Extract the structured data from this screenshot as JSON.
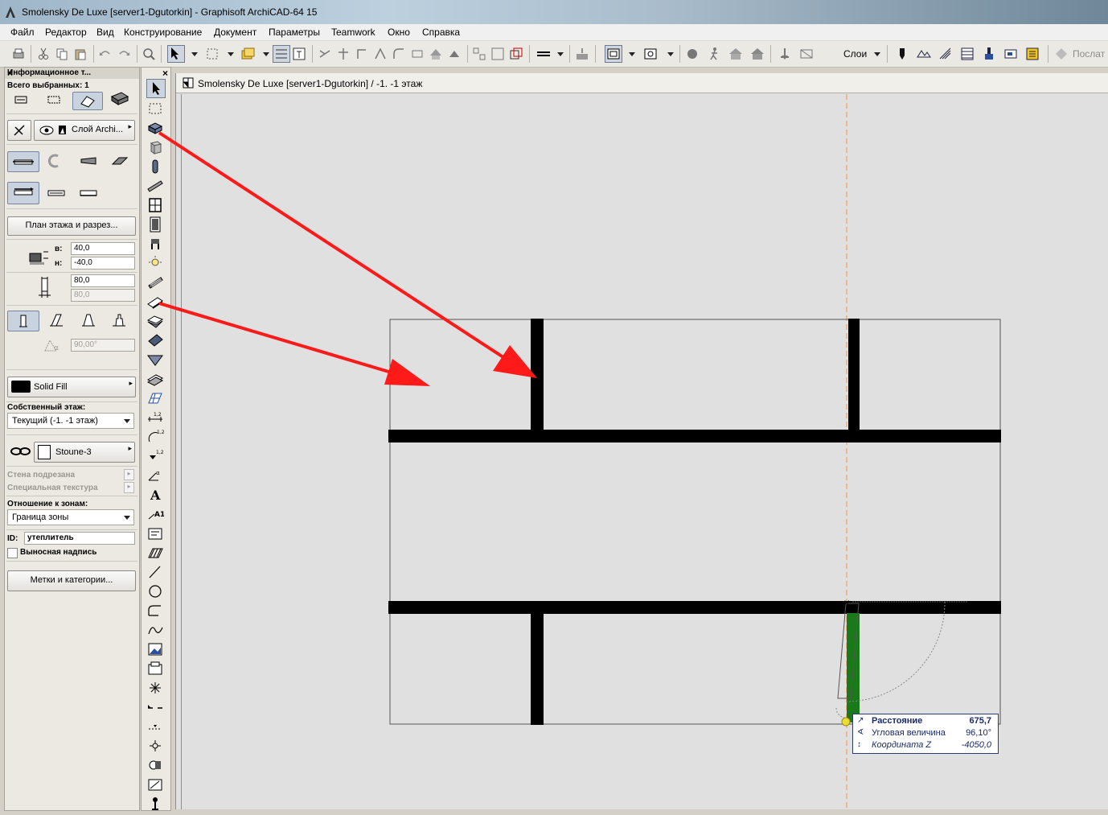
{
  "window": {
    "title": "Smolensky De Luxe  [server1-Dgutorkin] - Graphisoft ArchiCAD-64 15"
  },
  "menu": [
    "Файл",
    "Редактор",
    "Вид",
    "Конструирование",
    "Документ",
    "Параметры",
    "Teamwork",
    "Окно",
    "Справка"
  ],
  "toolbar": {
    "layers_label": "Слои",
    "last_label": "Послат"
  },
  "info_panel": {
    "title": "Информационное т...",
    "close": "×",
    "selected_count": "Всего выбранных: 1",
    "layer_label": "Слой Archi...",
    "plan_section_button": "План этажа и разрез...",
    "top_label": "в:",
    "top_value": "40,0",
    "bottom_label": "н:",
    "bottom_value": "-40,0",
    "thickness_value": "80,0",
    "thickness_value2": "80,0",
    "angle_value": "90,00°",
    "fill_label": "Solid Fill",
    "home_story_label": "Собственный этаж:",
    "home_story_value": "Текущий (-1. -1 этаж)",
    "material_label": "Stoune-3",
    "wall_cut_label": "Стена подрезана",
    "special_texture_label": "Специальная текстура",
    "zone_relation_label": "Отношение к зонам:",
    "zone_relation_value": "Граница зоны",
    "id_label": "ID:",
    "id_value": "утеплитель",
    "label_checkbox": "Выносная надпись",
    "tags_button": "Метки и категории..."
  },
  "toolbox": {
    "close": "×"
  },
  "drawing_window": {
    "title": "Smolensky De Luxe  [server1-Dgutorkin] / -1. -1 этаж"
  },
  "tracker": {
    "distance_label": "Расстояние",
    "distance_value": "675,7",
    "angle_label": "Угловая величина",
    "angle_value": "96,10°",
    "z_label": "Координата Z",
    "z_value": "-4050,0"
  },
  "colors": {
    "arrow": "#ff1a1a",
    "guide": "#ff9a5a",
    "wall": "#000000",
    "wall_highlight": "#1a7a1a",
    "canvas_bg": "#e0e0e0"
  }
}
